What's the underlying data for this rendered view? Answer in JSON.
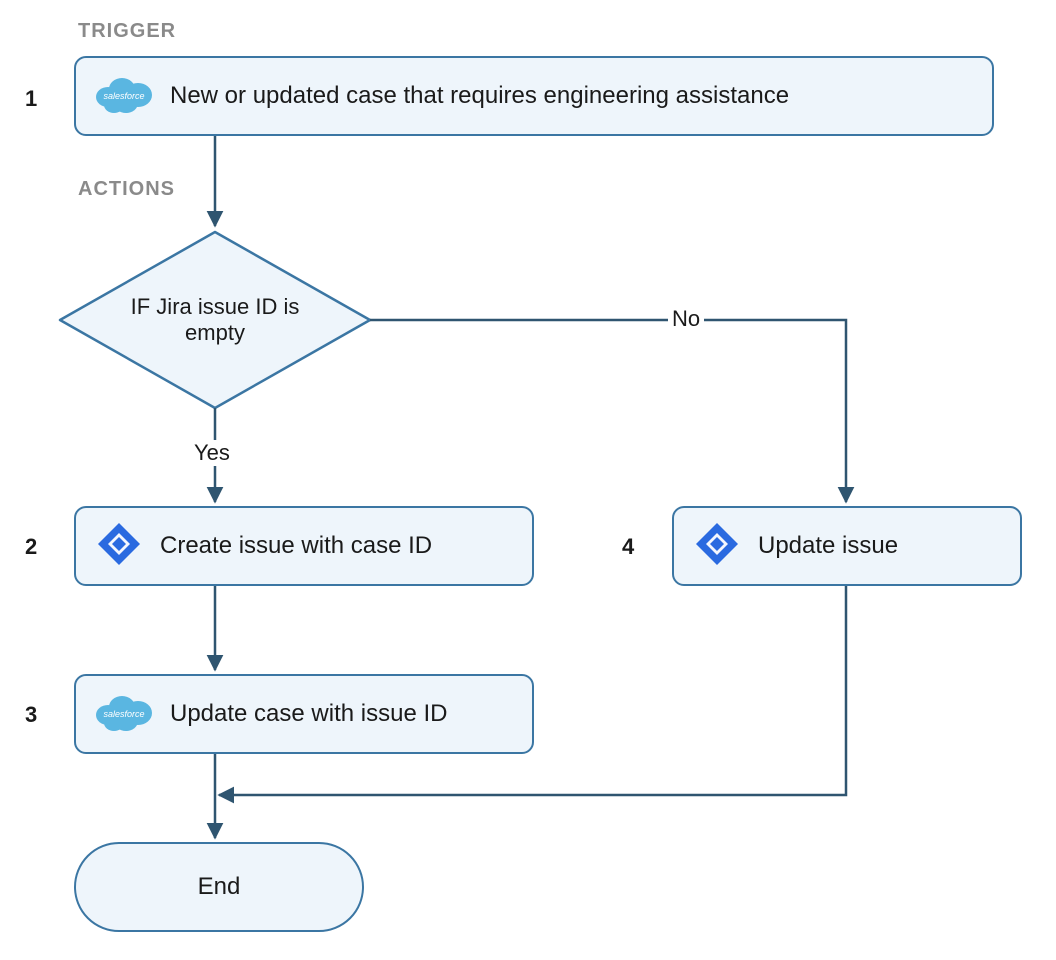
{
  "sections": {
    "trigger_label": "TRIGGER",
    "actions_label": "ACTIONS"
  },
  "nodes": {
    "trigger": {
      "num": "1",
      "text": "New or updated case that requires engineering assistance",
      "icon": "salesforce"
    },
    "decision": {
      "text": "IF Jira issue ID is empty"
    },
    "step2": {
      "num": "2",
      "text": "Create issue with case ID",
      "icon": "jira"
    },
    "step3": {
      "num": "3",
      "text": "Update case with issue ID",
      "icon": "salesforce"
    },
    "step4": {
      "num": "4",
      "text": "Update issue",
      "icon": "jira"
    },
    "end": {
      "text": "End"
    }
  },
  "edges": {
    "yes": "Yes",
    "no": "No"
  },
  "colors": {
    "node_border": "#3b76a3",
    "node_fill": "#eef5fb",
    "arrow": "#2f5570",
    "section_label": "#8a8a8a",
    "salesforce": "#5ab6e1",
    "jira": "#2a6ae0"
  }
}
